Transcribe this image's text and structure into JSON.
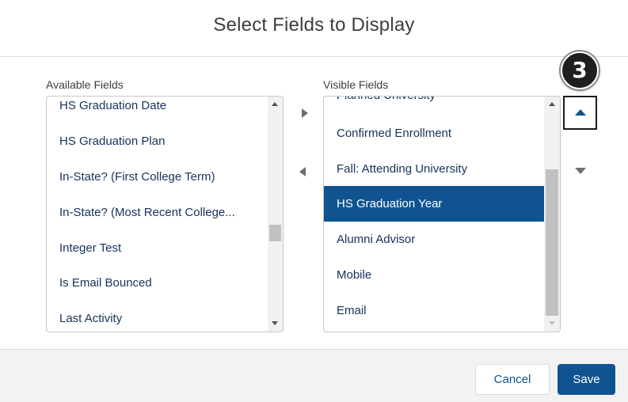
{
  "modal": {
    "title": "Select Fields to Display",
    "step_badge": "3"
  },
  "available": {
    "label": "Available Fields",
    "items": [
      "HS Graduation Date",
      "HS Graduation Plan",
      "In-State? (First College Term)",
      "In-State? (Most Recent College...",
      "Integer Test",
      "Is Email Bounced",
      "Last Activity"
    ]
  },
  "visible": {
    "label": "Visible Fields",
    "items": [
      "Planned University",
      "Confirmed Enrollment",
      "Fall: Attending University",
      "HS Graduation Year",
      "Alumni Advisor",
      "Mobile",
      "Email"
    ],
    "selected": "HS Graduation Year"
  },
  "footer": {
    "cancel_label": "Cancel",
    "save_label": "Save"
  },
  "colors": {
    "brand": "#0f5490",
    "selected_bg": "#0f5490",
    "text": "#16325c"
  },
  "icons": {
    "move_right": "triangle-right-icon",
    "move_left": "triangle-left-icon",
    "move_up": "triangle-up-icon",
    "move_down": "triangle-down-icon"
  }
}
